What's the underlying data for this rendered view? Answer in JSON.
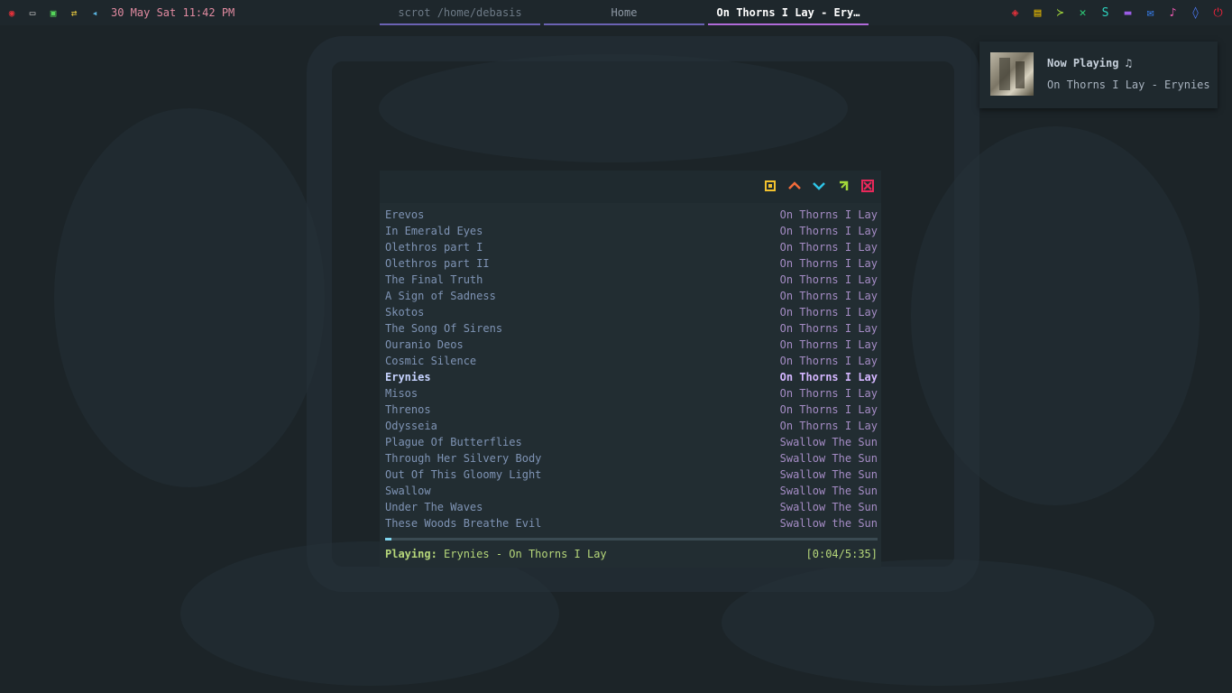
{
  "topbar": {
    "left_icons": [
      {
        "name": "arch-menu-icon",
        "glyph": "◉",
        "color": "#e0313a"
      },
      {
        "name": "keyboard-icon",
        "glyph": "▭",
        "color": "#c9c9c9"
      },
      {
        "name": "battery-icon",
        "glyph": "▣",
        "color": "#55d55a"
      },
      {
        "name": "network-icon",
        "glyph": "⇄",
        "color": "#f0d040"
      },
      {
        "name": "volume-icon",
        "glyph": "◂",
        "color": "#5ab4e0"
      }
    ],
    "clock": "30 May Sat 11:42 PM",
    "tabs": [
      "scrot /home/debasis",
      "Home",
      "On Thorns I Lay - Ery…"
    ],
    "right_icons": [
      {
        "name": "firefox-icon",
        "glyph": "◈",
        "color": "#e0313a"
      },
      {
        "name": "files-icon",
        "glyph": "▤",
        "color": "#e6b800"
      },
      {
        "name": "terminal-icon",
        "glyph": "≻",
        "color": "#9ed23a"
      },
      {
        "name": "vscode-icon",
        "glyph": "✕",
        "color": "#2fd07a"
      },
      {
        "name": "sublime-icon",
        "glyph": "S",
        "color": "#2dd4bf"
      },
      {
        "name": "folder-icon",
        "glyph": "▬",
        "color": "#9b5de5"
      },
      {
        "name": "mail-icon",
        "glyph": "✉",
        "color": "#3a86ff"
      },
      {
        "name": "music-icon",
        "glyph": "♪",
        "color": "#f15bb5"
      },
      {
        "name": "drop-icon",
        "glyph": "◊",
        "color": "#4d7cfe"
      },
      {
        "name": "power-icon",
        "glyph": "⏻",
        "color": "#ef233c"
      }
    ]
  },
  "notification": {
    "title": "Now Playing ♫",
    "body": "On Thorns I Lay - Erynies"
  },
  "player": {
    "controls": [
      {
        "name": "maximize-icon",
        "color": "#f2c12e"
      },
      {
        "name": "chevron-up-icon",
        "color": "#f26b3a"
      },
      {
        "name": "chevron-down-icon",
        "color": "#2ec4e6"
      },
      {
        "name": "move-icon",
        "color": "#a3d93a"
      },
      {
        "name": "close-icon",
        "color": "#e8285a"
      }
    ],
    "tracks": [
      {
        "title": "Erevos",
        "album": "On Thorns I Lay"
      },
      {
        "title": "In Emerald Eyes",
        "album": "On Thorns I Lay"
      },
      {
        "title": "Olethros part I",
        "album": "On Thorns I Lay"
      },
      {
        "title": "Olethros part II",
        "album": "On Thorns I Lay"
      },
      {
        "title": "The Final Truth",
        "album": "On Thorns I Lay"
      },
      {
        "title": "A Sign of Sadness",
        "album": "On Thorns I Lay"
      },
      {
        "title": "Skotos",
        "album": "On Thorns I Lay"
      },
      {
        "title": "The Song Of Sirens",
        "album": "On Thorns I Lay"
      },
      {
        "title": "Ouranio Deos",
        "album": "On Thorns I Lay"
      },
      {
        "title": "Cosmic Silence",
        "album": "On Thorns I Lay"
      },
      {
        "title": "Erynies",
        "album": "On Thorns I Lay"
      },
      {
        "title": "Misos",
        "album": "On Thorns I Lay"
      },
      {
        "title": "Threnos",
        "album": "On Thorns I Lay"
      },
      {
        "title": "Odysseia",
        "album": "On Thorns I Lay"
      },
      {
        "title": "Plague Of Butterflies",
        "album": "Swallow The Sun"
      },
      {
        "title": "Through Her Silvery Body",
        "album": "Swallow The Sun"
      },
      {
        "title": "Out Of This Gloomy Light",
        "album": "Swallow The Sun"
      },
      {
        "title": "Swallow",
        "album": "Swallow The Sun"
      },
      {
        "title": "Under The Waves",
        "album": "Swallow The Sun"
      },
      {
        "title": "These Woods Breathe Evil",
        "album": "Swallow the Sun"
      }
    ],
    "active_index": 10,
    "progress_fraction": 0.012,
    "status_label": "Playing:",
    "status_text": "Erynies - On Thorns I Lay",
    "time": "[0:04/5:35]"
  }
}
